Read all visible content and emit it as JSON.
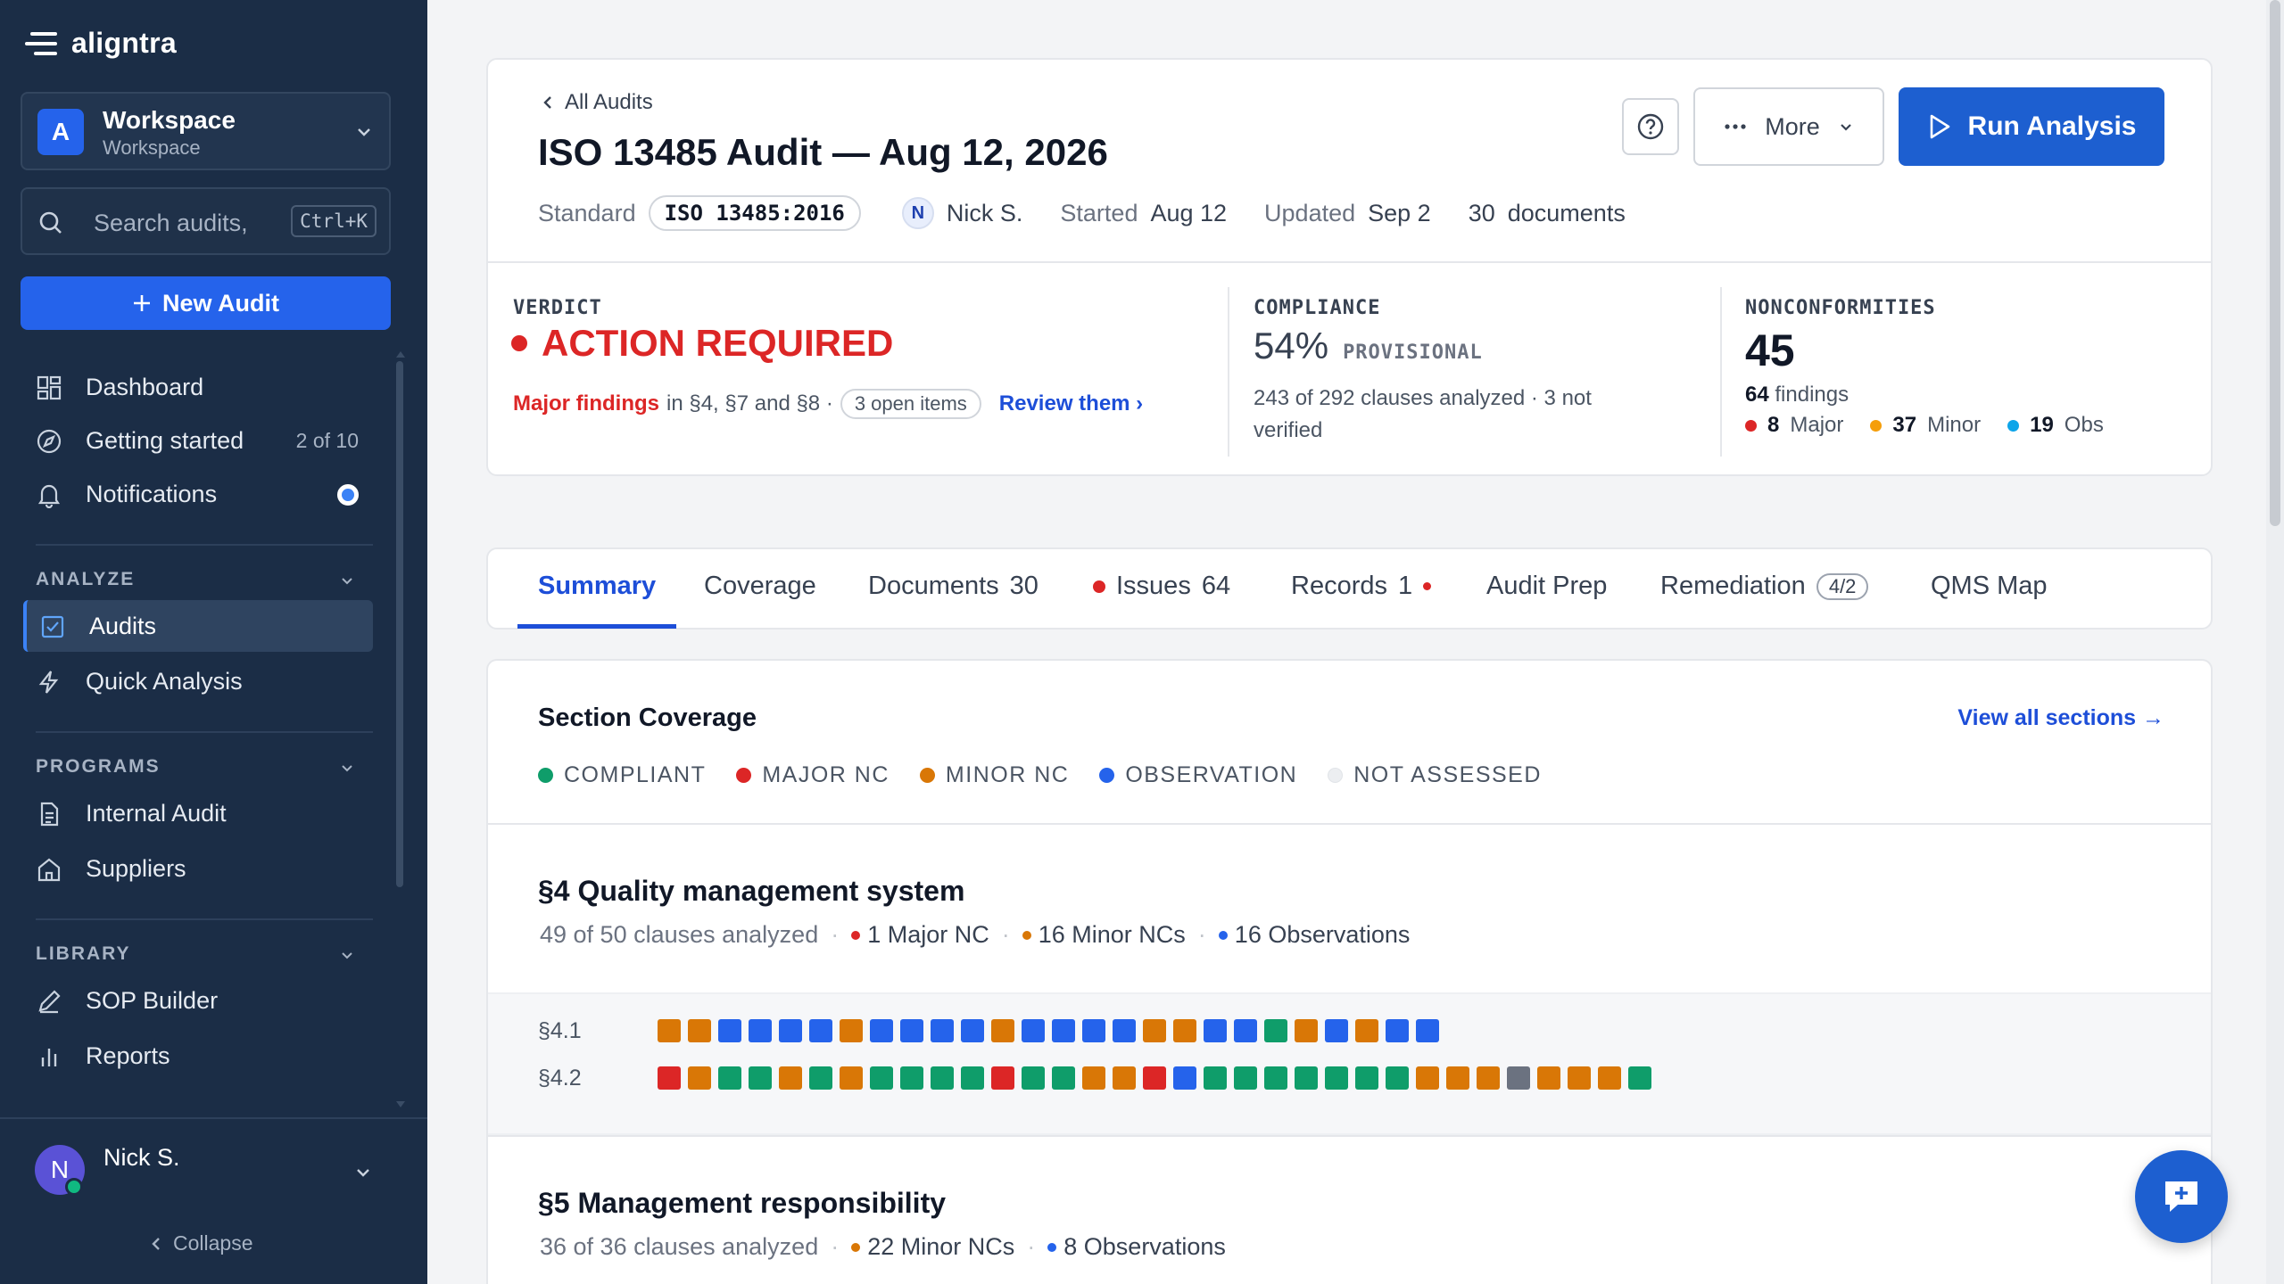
{
  "app": {
    "name": "aligntra"
  },
  "workspace": {
    "badge": "A",
    "name": "Workspace",
    "sub": "Workspace"
  },
  "search": {
    "placeholder": "Search audits,",
    "shortcut": "Ctrl+K"
  },
  "new_audit": {
    "label": "New Audit"
  },
  "nav": {
    "dashboard": "Dashboard",
    "getting_started": "Getting started",
    "getting_started_progress": "2 of 10",
    "notifications": "Notifications",
    "analyze_header": "ANALYZE",
    "audits": "Audits",
    "quick_analysis": "Quick Analysis",
    "programs_header": "PROGRAMS",
    "internal_audit": "Internal Audit",
    "suppliers": "Suppliers",
    "library_header": "LIBRARY",
    "sop_builder": "SOP Builder",
    "reports": "Reports"
  },
  "user": {
    "initial": "N",
    "name": "Nick S."
  },
  "collapse": "Collapse",
  "header": {
    "back": "All Audits",
    "title": "ISO 13485 Audit — Aug 12, 2026",
    "standard_label": "Standard",
    "standard": "ISO 13485:2016",
    "owner_initial": "N",
    "owner": "Nick S.",
    "started_label": "Started",
    "started": "Aug 12",
    "updated_label": "Updated",
    "updated": "Sep 2",
    "docs_count": "30",
    "docs_label": "documents",
    "more": "More",
    "run": "Run Analysis"
  },
  "verdict": {
    "label": "VERDICT",
    "value": "ACTION REQUIRED",
    "major_findings": "Major findings",
    "in_sections": "in §4, §7 and §8 ·",
    "open_items": "3 open items",
    "review": "Review them ›"
  },
  "compliance": {
    "label": "COMPLIANCE",
    "percent": "54%",
    "status": "PROVISIONAL",
    "detail": "243 of 292 clauses analyzed · 3 not verified"
  },
  "nonconformities": {
    "label": "NONCONFORMITIES",
    "total": "45",
    "findings_count": "64",
    "findings_label": "findings",
    "major_count": "8",
    "major_label": "Major",
    "minor_count": "37",
    "minor_label": "Minor",
    "obs_count": "19",
    "obs_label": "Obs"
  },
  "tabs": {
    "summary": "Summary",
    "coverage": "Coverage",
    "documents": "Documents",
    "documents_count": "30",
    "issues": "Issues",
    "issues_count": "64",
    "records": "Records",
    "records_count": "1",
    "audit_prep": "Audit Prep",
    "remediation": "Remediation",
    "remediation_badge": "4/2",
    "qms_map": "QMS Map"
  },
  "coverage": {
    "title": "Section Coverage",
    "view_all": "View all sections →",
    "legend": {
      "compliant": "COMPLIANT",
      "major": "MAJOR NC",
      "minor": "MINOR NC",
      "observation": "OBSERVATION",
      "not_assessed": "NOT ASSESSED"
    },
    "colors": {
      "compliant": "#0f9d6a",
      "major": "#dc2626",
      "minor": "#d97706",
      "observation": "#2563eb",
      "not_assessed": "#e5e7eb",
      "na_cell": "#6b7280"
    }
  },
  "sections": [
    {
      "title": "§4 Quality management system",
      "analyzed": "49 of 50 clauses analyzed",
      "major": "1 Major NC",
      "minor": "16 Minor NCs",
      "obs": "16 Observations",
      "rows": [
        {
          "label": "§4.1",
          "cells": [
            "m",
            "m",
            "o",
            "o",
            "o",
            "o",
            "m",
            "o",
            "o",
            "o",
            "o",
            "m",
            "o",
            "o",
            "o",
            "o",
            "m",
            "m",
            "o",
            "o",
            "c",
            "m",
            "o",
            "m",
            "o",
            "o"
          ]
        },
        {
          "label": "§4.2",
          "cells": [
            "M",
            "m",
            "c",
            "c",
            "m",
            "c",
            "m",
            "c",
            "c",
            "c",
            "c",
            "M",
            "c",
            "c",
            "m",
            "m",
            "M",
            "o",
            "c",
            "c",
            "c",
            "c",
            "c",
            "c",
            "c",
            "m",
            "m",
            "m",
            "g",
            "m",
            "m",
            "m",
            "c"
          ]
        }
      ]
    },
    {
      "title": "§5 Management responsibility",
      "analyzed": "36 of 36 clauses analyzed",
      "minor": "22 Minor NCs",
      "obs": "8 Observations"
    }
  ]
}
